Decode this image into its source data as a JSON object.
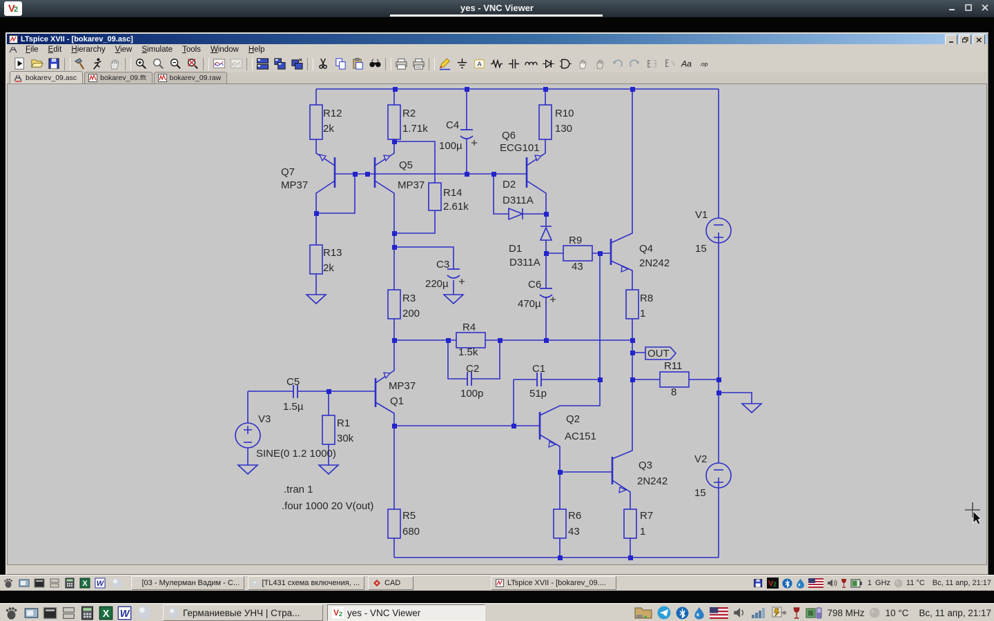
{
  "vnc": {
    "title": "yes - VNC Viewer"
  },
  "icons": {
    "excel": "X",
    "word": "W",
    "vnc_v": "V",
    "vnc_2": "2"
  },
  "ltspice": {
    "title": "LTspice XVII - [bokarev_09.asc]",
    "menu": [
      "File",
      "Edit",
      "Hierarchy",
      "View",
      "Simulate",
      "Tools",
      "Window",
      "Help"
    ],
    "toolbar": {
      "label_tool": "A",
      "text_tool": "Aa",
      "op_tool": ".op"
    },
    "tabs": [
      "bokarev_09.asc",
      "bokarev_09.fft",
      "bokarev_09.raw"
    ]
  },
  "schematic": {
    "out_flag": "OUT",
    "directives": {
      "tran": ".tran 1",
      "four": ".four 1000 20 V(out)"
    },
    "components": {
      "r12": {
        "label": "R12",
        "value": "2k"
      },
      "r2": {
        "label": "R2",
        "value": "1.71k"
      },
      "c4": {
        "label": "C4",
        "value": "100µ"
      },
      "r10": {
        "label": "R10",
        "value": "130"
      },
      "q6": {
        "label": "Q6",
        "value": "ECG101"
      },
      "q7": {
        "label": "Q7",
        "value": "MP37"
      },
      "q5": {
        "label": "Q5",
        "value": "MP37"
      },
      "r14": {
        "label": "R14",
        "value": "2.61k"
      },
      "d2": {
        "label": "D2",
        "value": "D311A"
      },
      "d1": {
        "label": "D1",
        "value": "D311A"
      },
      "r9": {
        "label": "R9",
        "value": "43"
      },
      "q4": {
        "label": "Q4",
        "value": "2N242"
      },
      "v1": {
        "label": "V1",
        "value": "15"
      },
      "r13": {
        "label": "R13",
        "value": "2k"
      },
      "c3": {
        "label": "C3",
        "value": "220µ"
      },
      "r3": {
        "label": "R3",
        "value": "200"
      },
      "c6": {
        "label": "C6",
        "value": "470µ"
      },
      "r8": {
        "label": "R8",
        "value": "1"
      },
      "r4": {
        "label": "R4",
        "value": "1.5k"
      },
      "c2": {
        "label": "C2",
        "value": "100p"
      },
      "c1": {
        "label": "C1",
        "value": "51p"
      },
      "r11": {
        "label": "R11",
        "value": "8"
      },
      "c5": {
        "label": "C5",
        "value": "1.5µ"
      },
      "v3": {
        "label": "V3",
        "value": "SINE(0 1.2 1000)"
      },
      "r1": {
        "label": "R1",
        "value": "30k"
      },
      "q1": {
        "label": "Q1",
        "value": "MP37"
      },
      "q2": {
        "label": "Q2",
        "value": "AC151"
      },
      "q3": {
        "label": "Q3",
        "value": "2N242"
      },
      "r6": {
        "label": "R6",
        "value": "43"
      },
      "r7": {
        "label": "R7",
        "value": "1"
      },
      "v2": {
        "label": "V2",
        "value": "15"
      },
      "r5": {
        "label": "R5",
        "value": "680"
      }
    }
  },
  "taskbar_inner": {
    "windows": [
      "[03 - Мулерман Вадим - С...",
      "[TL431 схема включения, ...",
      "CAD",
      "LTspice XVII - [bokarev_09...."
    ],
    "tray": {
      "cpu_count": "1",
      "cpu_freq": "GHz",
      "temp": "11 °C",
      "clock": "Вс, 11 апр, 21:17"
    }
  },
  "taskbar_outer": {
    "windows": [
      "Германиевые УНЧ | Стра...",
      "yes - VNC Viewer"
    ],
    "tray": {
      "cpu_freq": "798 MHz",
      "temp": "10 °C",
      "clock": "Вс, 11 апр, 21:17"
    }
  }
}
